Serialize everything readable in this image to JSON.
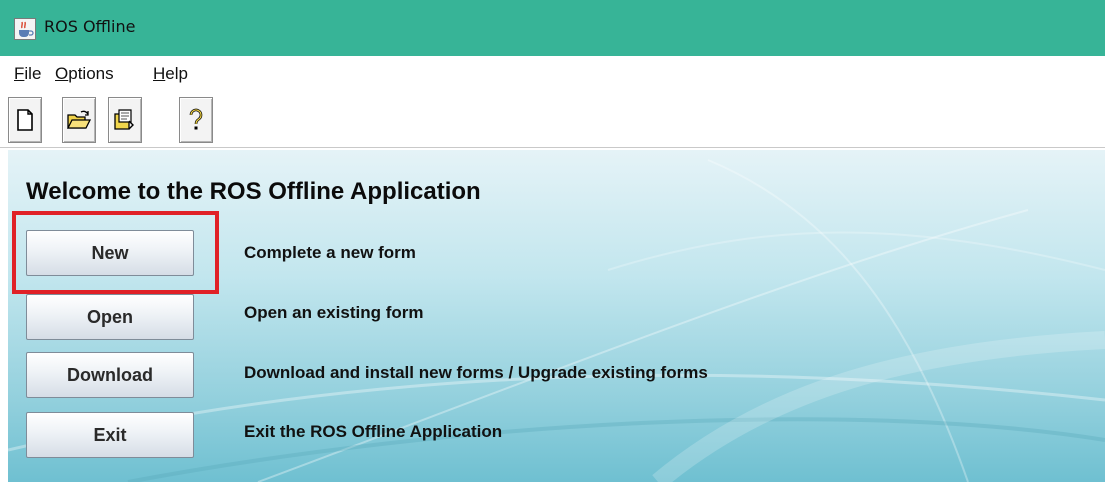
{
  "window": {
    "title": "ROS Offline",
    "app_icon": "java-cup-icon"
  },
  "menu": [
    {
      "mnemonic": "F",
      "rest": "ile"
    },
    {
      "mnemonic": "O",
      "rest": "ptions"
    },
    {
      "mnemonic": "H",
      "rest": "elp"
    }
  ],
  "toolbar": {
    "buttons": [
      {
        "icon": "new-document-icon"
      },
      {
        "icon": "open-folder-icon"
      },
      {
        "icon": "download-form-icon"
      },
      {
        "icon": "help-question-icon"
      }
    ]
  },
  "main": {
    "welcome": "Welcome to the ROS Offline Application",
    "actions": [
      {
        "label": "New",
        "description": "Complete a new form"
      },
      {
        "label": "Open",
        "description": "Open an existing form"
      },
      {
        "label": "Download",
        "description": "Download and install new forms / Upgrade existing forms"
      },
      {
        "label": "Exit",
        "description": "Exit the ROS Offline Application"
      }
    ]
  },
  "colors": {
    "titlebar": "#37b497",
    "highlight": "#e02127",
    "background_top": "#e5f3f7",
    "background_bottom": "#6fc0d1"
  }
}
